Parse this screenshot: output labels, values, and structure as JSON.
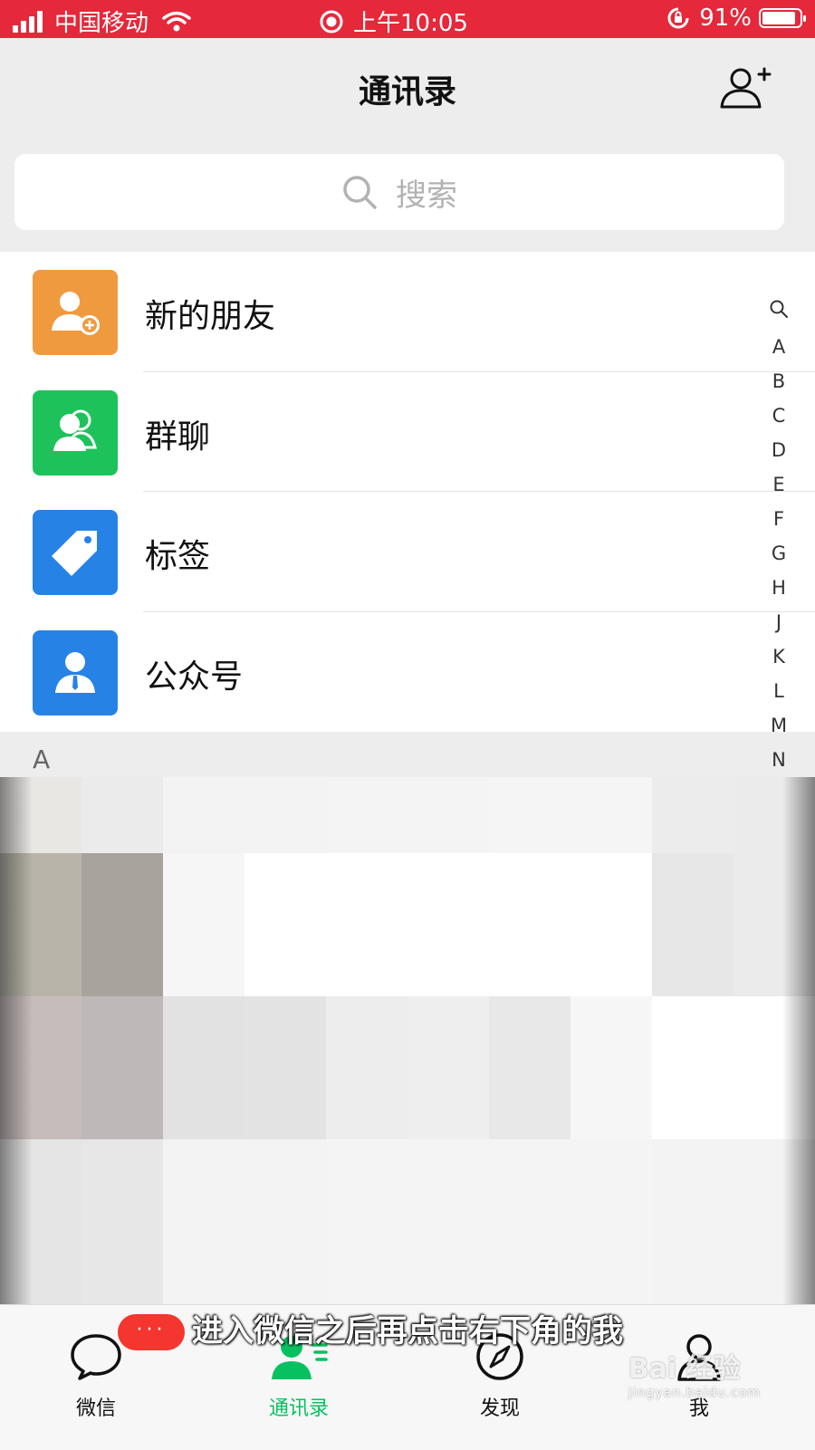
{
  "status_bar": {
    "carrier": "中国移动",
    "time": "上午10:05",
    "battery_percent": "91%",
    "battery_level": 0.91
  },
  "header": {
    "title": "通讯录"
  },
  "search": {
    "placeholder": "搜索"
  },
  "top_list": [
    {
      "label": "新的朋友",
      "icon": "add-friend-icon",
      "color": "#f09a3f"
    },
    {
      "label": "群聊",
      "icon": "group-chat-icon",
      "color": "#1ec25a"
    },
    {
      "label": "标签",
      "icon": "tag-icon",
      "color": "#2782e5"
    },
    {
      "label": "公众号",
      "icon": "official-account-icon",
      "color": "#2782e5"
    }
  ],
  "section_header": "A",
  "index_bar": [
    "A",
    "B",
    "C",
    "D",
    "E",
    "F",
    "G",
    "H",
    "J",
    "K",
    "L",
    "M",
    "N"
  ],
  "mosaic_colors": [
    "#e9e7e4",
    "#ebebeb",
    "#f3f3f3",
    "#f3f3f3",
    "#f4f4f4",
    "#f4f4f4",
    "#f5f5f5",
    "#f5f5f5",
    "#ececec",
    "#ebebeb",
    "#b8b4aa",
    "#a9a39e",
    "#f6f6f6",
    "#ffffff",
    "#ffffff",
    "#ffffff",
    "#ffffff",
    "#ffffff",
    "#e7e7e7",
    "#ebebeb",
    "#c7bcbc",
    "#bfb8b8",
    "#e2e2e2",
    "#e3e3e3",
    "#ededed",
    "#eeeeee",
    "#e8e8e8",
    "#f6f6f6",
    "#ffffff",
    "#ffffff",
    "#e5e5e5",
    "#e7e7e7",
    "#f3f3f3",
    "#f3f3f3",
    "#f4f4f4",
    "#f4f4f4",
    "#f4f4f4",
    "#f4f4f4",
    "#f3f3f3",
    "#f3f3f3"
  ],
  "subtitle": "进入微信之后再点击右下角的我",
  "tabs": [
    {
      "label": "微信",
      "icon": "chat-bubble-icon"
    },
    {
      "label": "通讯录",
      "icon": "contacts-icon",
      "active": true
    },
    {
      "label": "发现",
      "icon": "compass-icon"
    },
    {
      "label": "我",
      "icon": "person-icon"
    }
  ],
  "badge": "···",
  "watermark": {
    "brand": "Bai 经验",
    "url": "jingyan.baidu.com"
  },
  "colors": {
    "status_bar": "#e5283a",
    "accent_green": "#07c160",
    "badge_red": "#f43530"
  }
}
